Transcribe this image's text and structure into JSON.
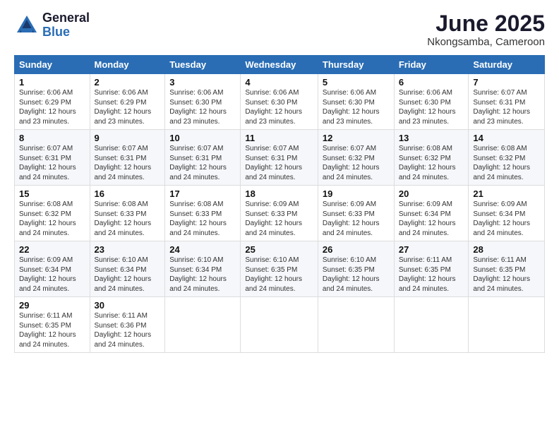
{
  "logo": {
    "general": "General",
    "blue": "Blue"
  },
  "title": "June 2025",
  "subtitle": "Nkongsamba, Cameroon",
  "weekdays": [
    "Sunday",
    "Monday",
    "Tuesday",
    "Wednesday",
    "Thursday",
    "Friday",
    "Saturday"
  ],
  "weeks": [
    [
      {
        "day": "1",
        "sunrise": "6:06 AM",
        "sunset": "6:29 PM",
        "daylight": "12 hours and 23 minutes."
      },
      {
        "day": "2",
        "sunrise": "6:06 AM",
        "sunset": "6:29 PM",
        "daylight": "12 hours and 23 minutes."
      },
      {
        "day": "3",
        "sunrise": "6:06 AM",
        "sunset": "6:30 PM",
        "daylight": "12 hours and 23 minutes."
      },
      {
        "day": "4",
        "sunrise": "6:06 AM",
        "sunset": "6:30 PM",
        "daylight": "12 hours and 23 minutes."
      },
      {
        "day": "5",
        "sunrise": "6:06 AM",
        "sunset": "6:30 PM",
        "daylight": "12 hours and 23 minutes."
      },
      {
        "day": "6",
        "sunrise": "6:06 AM",
        "sunset": "6:30 PM",
        "daylight": "12 hours and 23 minutes."
      },
      {
        "day": "7",
        "sunrise": "6:07 AM",
        "sunset": "6:31 PM",
        "daylight": "12 hours and 23 minutes."
      }
    ],
    [
      {
        "day": "8",
        "sunrise": "6:07 AM",
        "sunset": "6:31 PM",
        "daylight": "12 hours and 24 minutes."
      },
      {
        "day": "9",
        "sunrise": "6:07 AM",
        "sunset": "6:31 PM",
        "daylight": "12 hours and 24 minutes."
      },
      {
        "day": "10",
        "sunrise": "6:07 AM",
        "sunset": "6:31 PM",
        "daylight": "12 hours and 24 minutes."
      },
      {
        "day": "11",
        "sunrise": "6:07 AM",
        "sunset": "6:31 PM",
        "daylight": "12 hours and 24 minutes."
      },
      {
        "day": "12",
        "sunrise": "6:07 AM",
        "sunset": "6:32 PM",
        "daylight": "12 hours and 24 minutes."
      },
      {
        "day": "13",
        "sunrise": "6:08 AM",
        "sunset": "6:32 PM",
        "daylight": "12 hours and 24 minutes."
      },
      {
        "day": "14",
        "sunrise": "6:08 AM",
        "sunset": "6:32 PM",
        "daylight": "12 hours and 24 minutes."
      }
    ],
    [
      {
        "day": "15",
        "sunrise": "6:08 AM",
        "sunset": "6:32 PM",
        "daylight": "12 hours and 24 minutes."
      },
      {
        "day": "16",
        "sunrise": "6:08 AM",
        "sunset": "6:33 PM",
        "daylight": "12 hours and 24 minutes."
      },
      {
        "day": "17",
        "sunrise": "6:08 AM",
        "sunset": "6:33 PM",
        "daylight": "12 hours and 24 minutes."
      },
      {
        "day": "18",
        "sunrise": "6:09 AM",
        "sunset": "6:33 PM",
        "daylight": "12 hours and 24 minutes."
      },
      {
        "day": "19",
        "sunrise": "6:09 AM",
        "sunset": "6:33 PM",
        "daylight": "12 hours and 24 minutes."
      },
      {
        "day": "20",
        "sunrise": "6:09 AM",
        "sunset": "6:34 PM",
        "daylight": "12 hours and 24 minutes."
      },
      {
        "day": "21",
        "sunrise": "6:09 AM",
        "sunset": "6:34 PM",
        "daylight": "12 hours and 24 minutes."
      }
    ],
    [
      {
        "day": "22",
        "sunrise": "6:09 AM",
        "sunset": "6:34 PM",
        "daylight": "12 hours and 24 minutes."
      },
      {
        "day": "23",
        "sunrise": "6:10 AM",
        "sunset": "6:34 PM",
        "daylight": "12 hours and 24 minutes."
      },
      {
        "day": "24",
        "sunrise": "6:10 AM",
        "sunset": "6:34 PM",
        "daylight": "12 hours and 24 minutes."
      },
      {
        "day": "25",
        "sunrise": "6:10 AM",
        "sunset": "6:35 PM",
        "daylight": "12 hours and 24 minutes."
      },
      {
        "day": "26",
        "sunrise": "6:10 AM",
        "sunset": "6:35 PM",
        "daylight": "12 hours and 24 minutes."
      },
      {
        "day": "27",
        "sunrise": "6:11 AM",
        "sunset": "6:35 PM",
        "daylight": "12 hours and 24 minutes."
      },
      {
        "day": "28",
        "sunrise": "6:11 AM",
        "sunset": "6:35 PM",
        "daylight": "12 hours and 24 minutes."
      }
    ],
    [
      {
        "day": "29",
        "sunrise": "6:11 AM",
        "sunset": "6:35 PM",
        "daylight": "12 hours and 24 minutes."
      },
      {
        "day": "30",
        "sunrise": "6:11 AM",
        "sunset": "6:36 PM",
        "daylight": "12 hours and 24 minutes."
      },
      null,
      null,
      null,
      null,
      null
    ]
  ],
  "labels": {
    "sunrise": "Sunrise:",
    "sunset": "Sunset:",
    "daylight": "Daylight:"
  }
}
